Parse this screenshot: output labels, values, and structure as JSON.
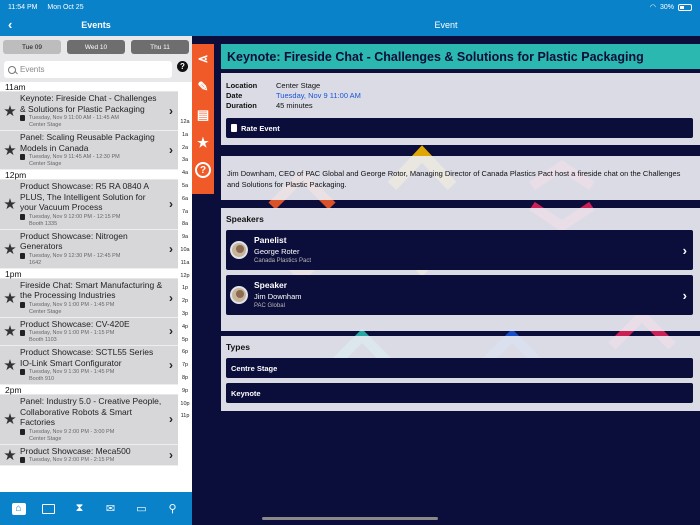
{
  "status": {
    "time": "11:54 PM",
    "date": "Mon Oct 25",
    "battery": "30%"
  },
  "left": {
    "title": "Events",
    "days": [
      "Tue 09",
      "Wed 10",
      "Thu 11"
    ],
    "search_placeholder": "Events",
    "groups": [
      {
        "hour": "11am",
        "items": [
          {
            "title": "Keynote: Fireside Chat - Challenges & Solutions for Plastic Packaging",
            "time": "Tuesday, Nov 9 11:00 AM - 11:45 AM",
            "location": "Center Stage",
            "lines": 3
          },
          {
            "title": "Panel: Scaling Reusable Packaging Models in Canada",
            "time": "Tuesday, Nov 9 11:45 AM - 12:30 PM",
            "location": "Center Stage",
            "lines": 2
          }
        ]
      },
      {
        "hour": "12pm",
        "items": [
          {
            "title": "Product Showcase: R5 RA 0840 A PLUS, The Intelligent Solution for your Vacuum Process",
            "time": "Tuesday, Nov 9 12:00 PM - 12:15 PM",
            "location": "Booth 1335",
            "lines": 3
          },
          {
            "title": "Product Showcase: Nitrogen Generators",
            "time": "Tuesday, Nov 9 12:30 PM - 12:45 PM",
            "location": "1642",
            "lines": 2
          }
        ]
      },
      {
        "hour": "1pm",
        "items": [
          {
            "title": "Fireside Chat: Smart Manufacturing & the Processing Industries",
            "time": "Tuesday, Nov 9 1:00 PM - 1:45 PM",
            "location": "Center Stage",
            "lines": 3
          },
          {
            "title": "Product Showcase: CV-420E",
            "time": "Tuesday, Nov 9 1:00 PM - 1:15 PM",
            "location": "Booth 1103",
            "lines": 1
          },
          {
            "title": "Product Showcase: SCTL55 Series IO-Link Smart Configurator",
            "time": "Tuesday, Nov 9 1:30 PM - 1:45 PM",
            "location": "Booth 910",
            "lines": 2
          }
        ]
      },
      {
        "hour": "2pm",
        "items": [
          {
            "title": "Panel: Industry 5.0 - Creative People, Collaborative Robots & Smart Factories",
            "time": "Tuesday, Nov 9 2:00 PM - 3:00 PM",
            "location": "Center Stage",
            "lines": 3
          },
          {
            "title": "Product Showcase: Meca500",
            "time": "Tuesday, Nov 9 2:00 PM - 2:15 PM",
            "location": "",
            "lines": 1
          }
        ]
      }
    ],
    "index": [
      "12a",
      "1a",
      "2a",
      "3a",
      "4a",
      "5a",
      "6a",
      "7a",
      "8a",
      "9a",
      "10a",
      "11a",
      "12p",
      "1p",
      "2p",
      "3p",
      "4p",
      "5p",
      "6p",
      "7p",
      "8p",
      "9p",
      "10p",
      "11p"
    ],
    "tabs": [
      "home-icon",
      "map-icon",
      "schedule-icon",
      "mail-icon",
      "badge-icon",
      "search-icon"
    ]
  },
  "event": {
    "header": "Event",
    "title": "Keynote: Fireside Chat - Challenges & Solutions for Plastic Packaging",
    "labels": {
      "location": "Location",
      "date": "Date",
      "duration": "Duration"
    },
    "location": "Center Stage",
    "date": "Tuesday, Nov 9 11:00 AM",
    "duration": "45 minutes",
    "rate_label": "Rate Event",
    "description": "Jim Downham, CEO of PAC Global and George Rotor, Managing Director of Canada Plastics Pact host a fireside chat on the Challenges and Solutions for Plastic Packaging.",
    "speakers_heading": "Speakers",
    "speakers": [
      {
        "role": "Panelist",
        "name": "George Roter",
        "org": "Canada Plastics Pact"
      },
      {
        "role": "Speaker",
        "name": "Jim Downham",
        "org": "PAC Global"
      }
    ],
    "types_heading": "Types",
    "types": [
      "Centre Stage",
      "Keynote"
    ]
  },
  "colors": {
    "accent": "#0a82c9",
    "navy": "#0b0d3a",
    "orange": "#f05a28",
    "teal": "#2bb8b0"
  }
}
